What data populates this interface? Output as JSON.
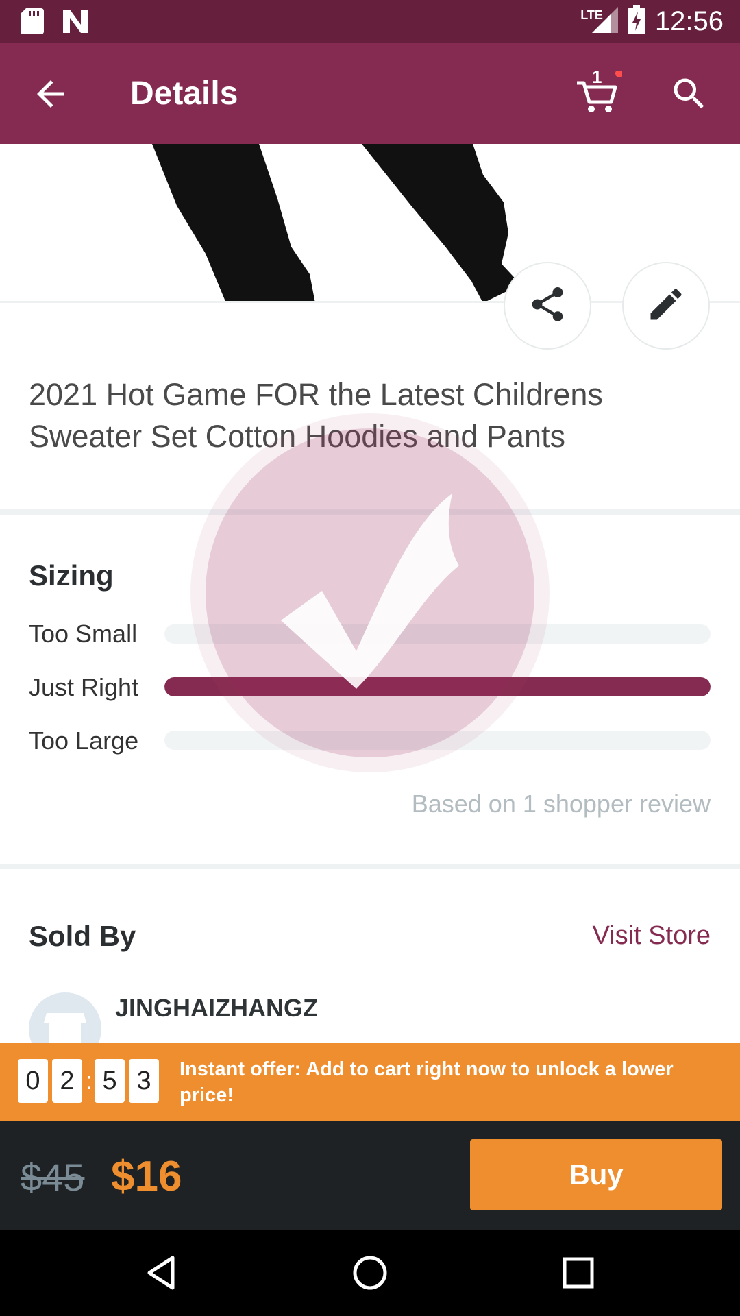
{
  "status_bar": {
    "network": "LTE",
    "time": "12:56",
    "icons": [
      "sd-card-icon",
      "n-icon",
      "signal-icon",
      "battery-icon"
    ]
  },
  "app_bar": {
    "title": "Details",
    "cart_count": "1",
    "icons": [
      "back-arrow-icon",
      "cart-icon",
      "search-icon"
    ]
  },
  "product": {
    "title": "2021 Hot Game FOR the Latest Childrens Sweater Set Cotton Hoodies and Pants",
    "actions": [
      "share-icon",
      "edit-icon"
    ]
  },
  "sizing": {
    "heading": "Sizing",
    "options": [
      {
        "label": "Too Small",
        "fraction": 0
      },
      {
        "label": "Just Right",
        "fraction": 1
      },
      {
        "label": "Too Large",
        "fraction": 0
      }
    ],
    "footnote": "Based on 1 shopper review"
  },
  "seller": {
    "heading": "Sold By",
    "visit_label": "Visit Store",
    "name": "JINGHAIZHANGZ"
  },
  "offer": {
    "digits": [
      "0",
      "2",
      "5",
      "3"
    ],
    "text": "Instant offer: Add to cart right now to unlock a lower price!"
  },
  "pricing": {
    "old_price": "$45",
    "new_price": "$16",
    "buy_label": "Buy"
  },
  "colors": {
    "brand": "#852a50",
    "status_bar": "#661f3d",
    "accent": "#ef8e2e",
    "bottom_bar": "#1e2225"
  }
}
